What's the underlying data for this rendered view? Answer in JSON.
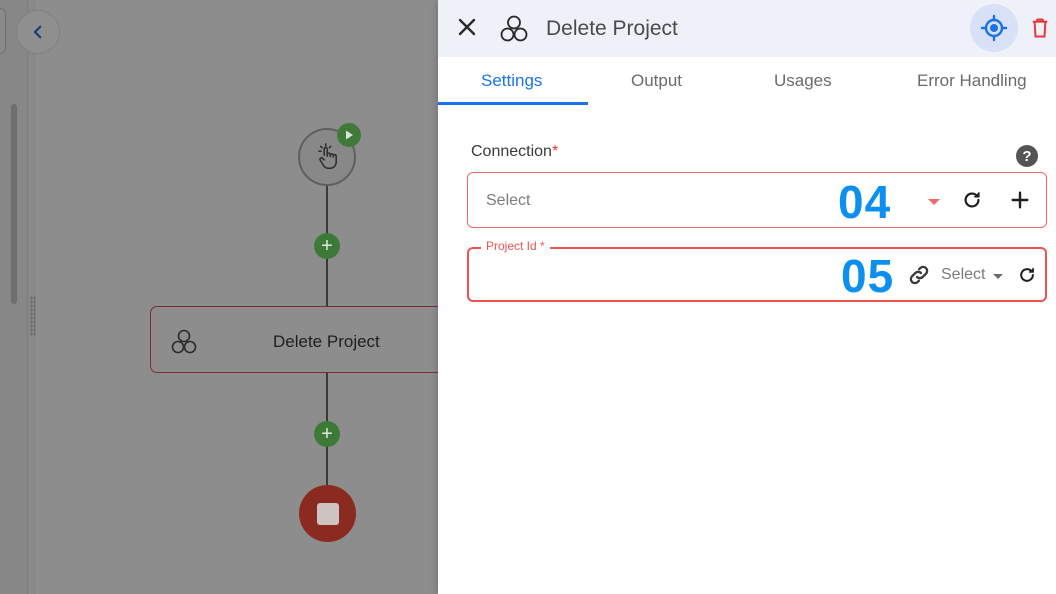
{
  "canvas": {
    "step_node_label": "Delete Project",
    "add_symbol": "+"
  },
  "panel": {
    "title": "Delete Project",
    "tabs": [
      {
        "label": "Settings",
        "active": true
      },
      {
        "label": "Output",
        "active": false
      },
      {
        "label": "Usages",
        "active": false
      },
      {
        "label": "Error Handling",
        "active": false
      }
    ],
    "connection": {
      "label": "Connection",
      "required_mark": "*",
      "placeholder": "Select",
      "step_badge": "04",
      "help_symbol": "?"
    },
    "project_id": {
      "label": "Project Id *",
      "select_label": "Select",
      "step_badge": "05"
    }
  },
  "icons": {
    "close": "close-icon",
    "app": "app-circles-icon",
    "locate": "crosshair-icon",
    "delete": "trash-icon",
    "refresh": "refresh-icon",
    "add": "plus-icon",
    "link": "link-icon",
    "trigger": "hand-pointer-icon",
    "play": "play-icon"
  },
  "colors": {
    "accent": "#1a73e8",
    "error": "#ef5350",
    "delete": "#e53935",
    "badge": "#0d8ff0",
    "add_button": "#3d7a38",
    "stop_node": "#8a2a20"
  }
}
